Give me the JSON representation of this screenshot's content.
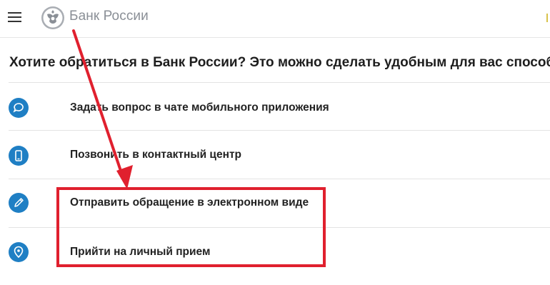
{
  "header": {
    "menu_icon": "hamburger-menu-icon",
    "logo_icon": "bank-emblem-icon",
    "brand": "Банк России"
  },
  "main": {
    "title": "Хотите обратиться в Банк России? Это можно сделать удобным для вас способом:",
    "options": [
      {
        "label": "Задать вопрос в чате мобильного приложения",
        "icon": "chat-bubble-icon"
      },
      {
        "label": "Позвонить в контактный центр",
        "icon": "phone-icon"
      },
      {
        "label": "Отправить обращение в электронном виде",
        "icon": "pencil-icon"
      },
      {
        "label": "Прийти на личный прием",
        "icon": "location-pin-icon"
      }
    ]
  },
  "annotation": {
    "color": "#e0202e",
    "highlighted_options": [
      "Отправить обращение в электронном виде",
      "Прийти на личный прием"
    ]
  },
  "colors": {
    "accent": "#1f7fc4",
    "brand_text": "#8a8f96",
    "annotation": "#e0202e"
  }
}
